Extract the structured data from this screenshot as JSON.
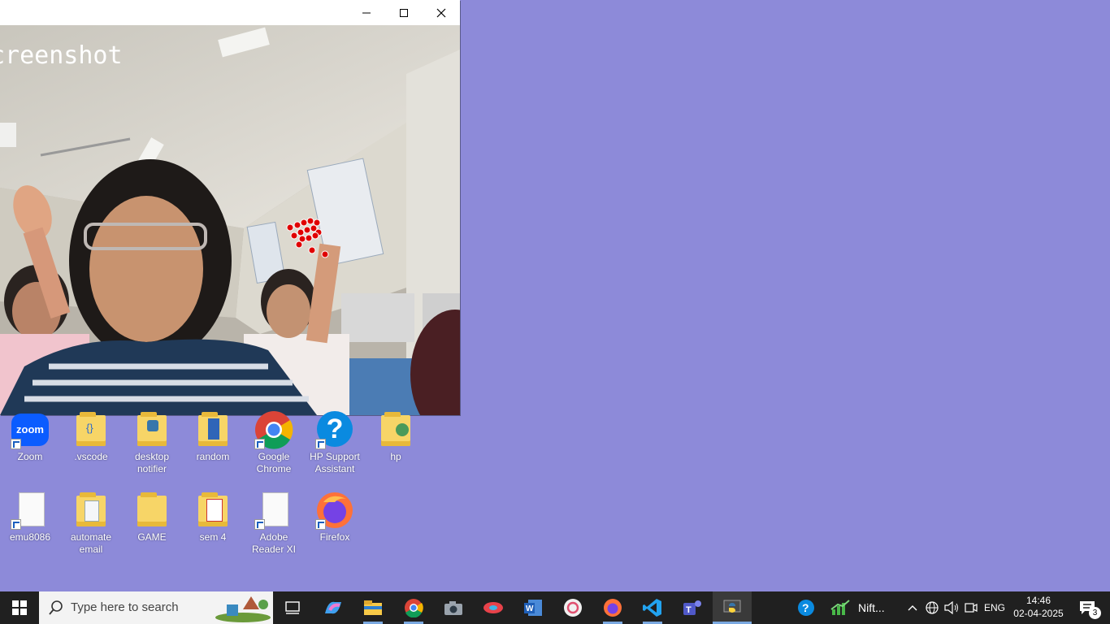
{
  "window": {
    "overlay_text": "creenshot",
    "controls": {
      "minimize": "minimize-icon",
      "maximize": "maximize-icon",
      "close": "close-icon"
    }
  },
  "desktop_icons": [
    {
      "id": "zoom",
      "label": "Zoom",
      "icon": "zoom-icon"
    },
    {
      "id": "vscode-folder",
      "label": ".vscode",
      "icon": "folder-icon"
    },
    {
      "id": "desktop-notifier",
      "label": "desktop\nnotifier",
      "icon": "folder-icon"
    },
    {
      "id": "random",
      "label": "random",
      "icon": "folder-icon"
    },
    {
      "id": "google-chrome",
      "label": "Google\nChrome",
      "icon": "chrome-icon"
    },
    {
      "id": "hp-support",
      "label": "HP Support\nAssistant",
      "icon": "help-icon"
    },
    {
      "id": "hp",
      "label": "hp",
      "icon": "user-folder-icon"
    },
    {
      "id": "emu8086",
      "label": "emu8086",
      "icon": "document-icon"
    },
    {
      "id": "automate-email",
      "label": "automate\nemail",
      "icon": "folder-icon"
    },
    {
      "id": "game",
      "label": "GAME",
      "icon": "folder-icon"
    },
    {
      "id": "sem4",
      "label": "sem 4",
      "icon": "pdf-folder-icon"
    },
    {
      "id": "adobe-reader",
      "label": "Adobe\nReader XI",
      "icon": "document-icon"
    },
    {
      "id": "firefox",
      "label": "Firefox",
      "icon": "firefox-icon"
    }
  ],
  "taskbar": {
    "search_placeholder": "Type here to search",
    "apps": [
      "start-icon",
      "task-view-icon",
      "copilot-icon",
      "file-explorer-icon",
      "chrome-icon",
      "camera-icon",
      "snipping-tool-icon",
      "word-icon",
      "app-icon",
      "firefox-icon",
      "vscode-icon",
      "teams-icon",
      "python-icon"
    ],
    "tray": {
      "stock_label": "Nift...",
      "language": "ENG",
      "time": "14:46",
      "date": "02-04-2025",
      "notification_count": "3"
    }
  },
  "colors": {
    "desktop": "#8d8ad9",
    "taskbar": "#202020",
    "accent": "#7aa8e0"
  }
}
